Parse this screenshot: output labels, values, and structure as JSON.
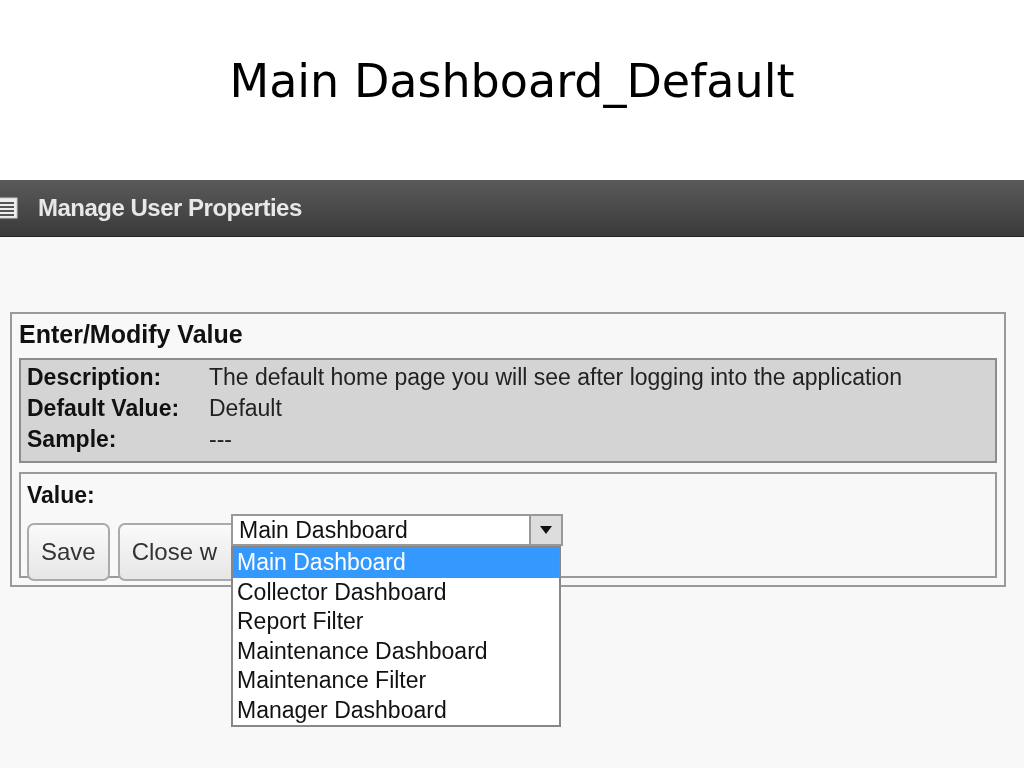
{
  "slide_title": "Main Dashboard_Default",
  "header": {
    "title": "Manage User Properties"
  },
  "panel": {
    "heading": "Enter/Modify Value",
    "info": [
      {
        "label": "Description:",
        "value": "The default home page you will see after logging into the application"
      },
      {
        "label": "Default Value:",
        "value": "Default"
      },
      {
        "label": "Sample:",
        "value": "---"
      }
    ],
    "value_label": "Value:",
    "select": {
      "value": "Main Dashboard",
      "expanded": true,
      "options": [
        {
          "label": "Main Dashboard",
          "selected": true
        },
        {
          "label": "Collector Dashboard",
          "selected": false
        },
        {
          "label": "Report Filter",
          "selected": false
        },
        {
          "label": "Maintenance Dashboard",
          "selected": false
        },
        {
          "label": "Maintenance Filter",
          "selected": false
        },
        {
          "label": "Manager Dashboard",
          "selected": false
        }
      ]
    },
    "buttons": [
      "Save",
      "Close w"
    ]
  }
}
